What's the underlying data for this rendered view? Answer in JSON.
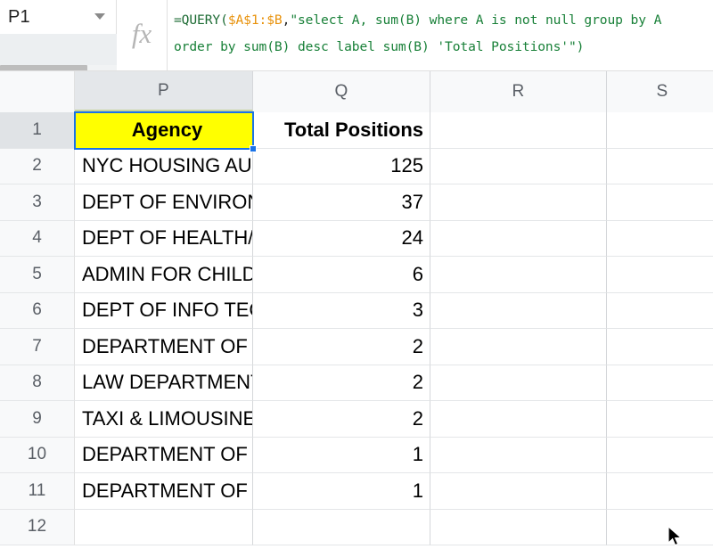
{
  "app": {
    "name_box_value": "P1",
    "fx_label": "fx",
    "formula_segments": [
      {
        "text": "=QUERY(",
        "kind": "fn"
      },
      {
        "text": "$A$1:$B",
        "kind": "ref"
      },
      {
        "text": ",",
        "kind": "plain"
      },
      {
        "text": "\"select A, sum(B) where A is not null group by A",
        "kind": "str"
      }
    ],
    "formula_line2": [
      {
        "text": "order by sum(B) desc label sum(B) 'Total Positions'\")",
        "kind": "str"
      }
    ],
    "formula_full": "=QUERY($A$1:$B,\"select A, sum(B) where A is not null group by A order by sum(B) desc label sum(B) 'Total Positions'\")"
  },
  "grid": {
    "column_headers": [
      "P",
      "Q",
      "R",
      "S"
    ],
    "selected_column": "P",
    "selected_row": "1",
    "selected_cell": "P1",
    "row_numbers": [
      "1",
      "2",
      "3",
      "4",
      "5",
      "6",
      "7",
      "8",
      "9",
      "10",
      "11",
      "12"
    ],
    "rows": [
      {
        "num": "1",
        "agency": "Agency",
        "total": "Total Positions"
      },
      {
        "num": "2",
        "agency": "NYC HOUSING AUTHORITY",
        "total": "125"
      },
      {
        "num": "3",
        "agency": "DEPT OF ENVIRONMENT PROTECTION",
        "total": "37"
      },
      {
        "num": "4",
        "agency": "DEPT OF HEALTH/MENTAL HYGIENE",
        "total": "24"
      },
      {
        "num": "5",
        "agency": "ADMIN FOR CHILDREN'S SVCS",
        "total": "6"
      },
      {
        "num": "6",
        "agency": "DEPT OF INFO TECH & TELECOMM",
        "total": "3"
      },
      {
        "num": "7",
        "agency": "DEPARTMENT OF CORRECTION",
        "total": "2"
      },
      {
        "num": "8",
        "agency": "LAW DEPARTMENT",
        "total": "2"
      },
      {
        "num": "9",
        "agency": "TAXI & LIMOUSINE COMMISSION",
        "total": "2"
      },
      {
        "num": "10",
        "agency": "DEPARTMENT OF BUSINESS SERV.",
        "total": "1"
      },
      {
        "num": "11",
        "agency": "DEPARTMENT OF TRANSPORTATION",
        "total": "1"
      },
      {
        "num": "12",
        "agency": "",
        "total": ""
      }
    ]
  },
  "colors": {
    "highlight_yellow": "#ffff00",
    "selection_blue": "#1a73e8",
    "formula_string_green": "#188038",
    "formula_ref_orange": "#e8920c",
    "header_gray": "#f8f9fa"
  }
}
